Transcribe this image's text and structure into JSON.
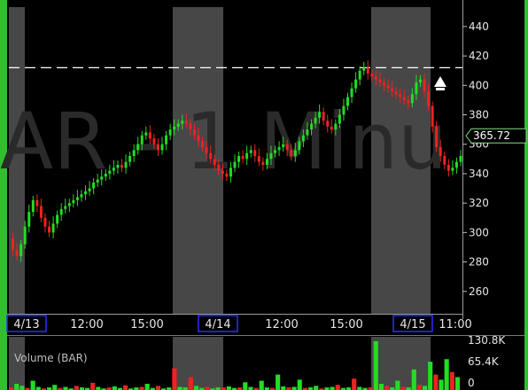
{
  "chart_data": {
    "type": "line",
    "watermark": "AR - 1 Minu",
    "price_axis": {
      "ticks": [
        260,
        280,
        300,
        320,
        340,
        360,
        380,
        400,
        420,
        440
      ],
      "ylim": [
        246,
        452
      ],
      "last_price": "365.72",
      "resistance_level": 412
    },
    "time_axis": {
      "labels": [
        "4/13",
        "12:00",
        "15:00",
        "4/14",
        "12:00",
        "15:00",
        "4/15",
        "11:00"
      ],
      "boxed_labels": [
        "4/13",
        "4/14",
        "4/15"
      ]
    },
    "premarket_bands": [
      "4/13",
      "4/14",
      "4/15"
    ],
    "series": [
      {
        "values": [
          296,
          288,
          284,
          292,
          304,
          314,
          322,
          318,
          310,
          304,
          300,
          306,
          312,
          316,
          318,
          320,
          322,
          324,
          326,
          328,
          330,
          334,
          336,
          338,
          340,
          342,
          344,
          346,
          344,
          348,
          352,
          356,
          360,
          366,
          368,
          364,
          360,
          356,
          360,
          366,
          370,
          372,
          374,
          376,
          374,
          370,
          366,
          362,
          358,
          354,
          350,
          346,
          342,
          340,
          338,
          344,
          348,
          352,
          350,
          354,
          356,
          352,
          348,
          346,
          350,
          354,
          356,
          358,
          360,
          356,
          352,
          356,
          362,
          366,
          370,
          374,
          378,
          382,
          376,
          372,
          370,
          374,
          380,
          386,
          392,
          398,
          404,
          410,
          412,
          408,
          406,
          404,
          402,
          400,
          398,
          396,
          394,
          392,
          390,
          388,
          394,
          402,
          404,
          396,
          386,
          372,
          358,
          352,
          346,
          342,
          344,
          348,
          352
        ]
      }
    ],
    "volume": {
      "label": "Volume (BAR)",
      "ticks": [
        "130.8K",
        "65.4K",
        "0"
      ],
      "values": [
        0.05,
        0.12,
        0.08,
        0.04,
        0.18,
        0.06,
        0.03,
        0.05,
        0.1,
        0.04,
        0.06,
        0.03,
        0.08,
        0.05,
        0.04,
        0.14,
        0.06,
        0.03,
        0.05,
        0.07,
        0.04,
        0.09,
        0.03,
        0.05,
        0.06,
        0.12,
        0.04,
        0.08,
        0.03,
        0.05,
        0.42,
        0.06,
        0.05,
        0.25,
        0.08,
        0.04,
        0.06,
        0.03,
        0.05,
        0.05,
        0.07,
        0.04,
        0.05,
        0.15,
        0.06,
        0.04,
        0.18,
        0.05,
        0.04,
        0.3,
        0.07,
        0.05,
        0.06,
        0.2,
        0.04,
        0.05,
        0.08,
        0.03,
        0.05,
        0.06,
        0.1,
        0.04,
        0.05,
        0.22,
        0.06,
        0.04,
        0.05,
        0.95,
        0.12,
        0.08,
        0.05,
        0.18,
        0.06,
        0.05,
        0.4,
        0.1,
        0.08,
        0.55,
        0.3,
        0.2,
        0.6,
        0.35,
        0.25
      ]
    }
  }
}
